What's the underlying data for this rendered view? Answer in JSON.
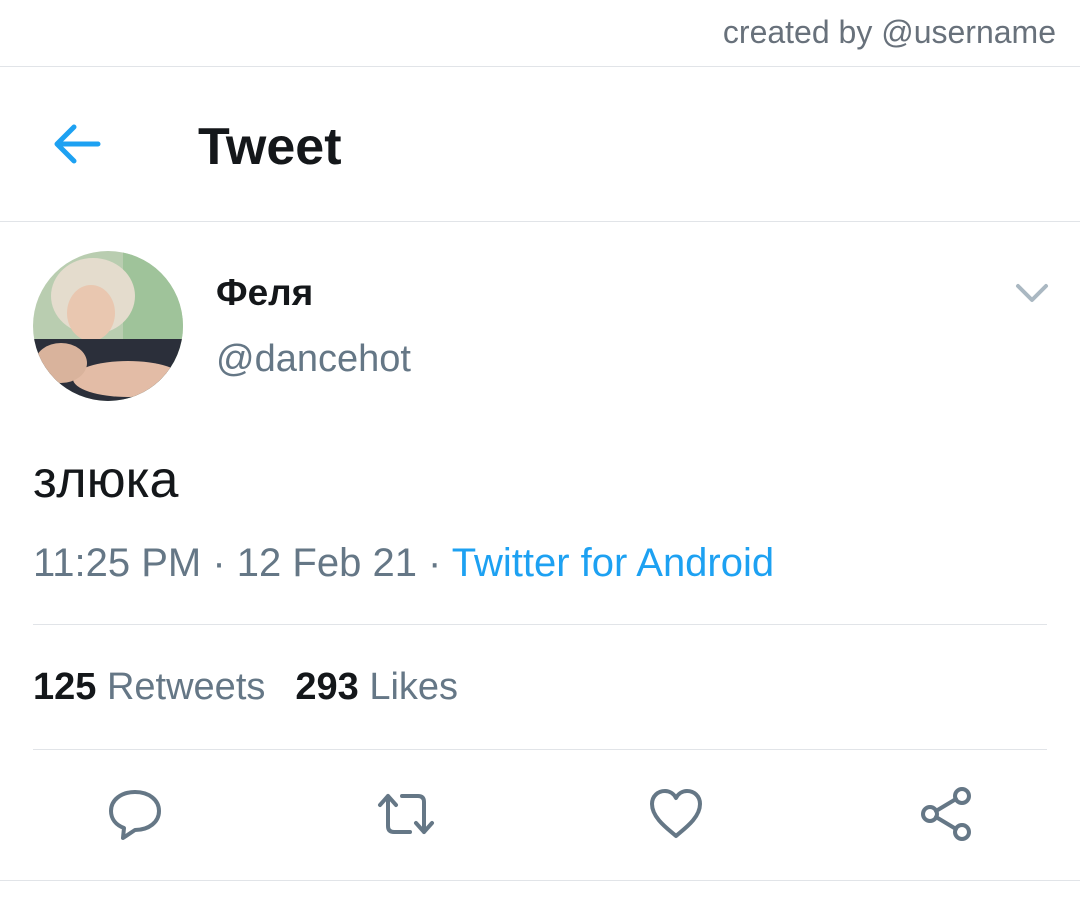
{
  "credit": "created by @username",
  "header": {
    "back_icon": "arrow-left-icon",
    "title": "Tweet"
  },
  "author": {
    "name": "Феля",
    "handle": "@dancehot"
  },
  "tweet": {
    "text": "злюка",
    "time": "11:25 PM",
    "separator": " · ",
    "date": "12 Feb 21",
    "source": "Twitter for Android"
  },
  "stats": {
    "retweets_count": "125",
    "retweets_label": "Retweets",
    "likes_count": "293",
    "likes_label": "Likes"
  },
  "actions": {
    "reply_icon": "speech-bubble-icon",
    "retweet_icon": "retweet-icon",
    "like_icon": "heart-icon",
    "share_icon": "share-icon"
  },
  "colors": {
    "accent": "#1da1f2",
    "text": "#14171a",
    "secondary": "#657786",
    "divider": "#e1e4e8"
  }
}
